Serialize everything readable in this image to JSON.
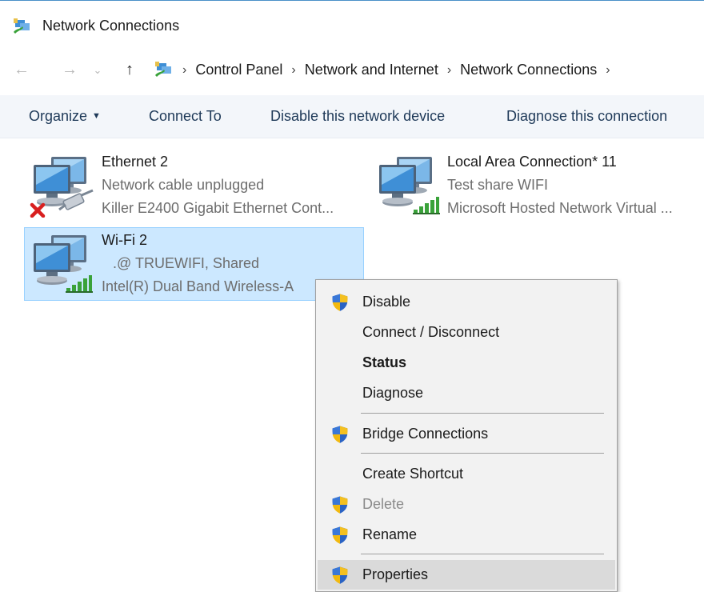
{
  "window": {
    "title": "Network Connections"
  },
  "address": {
    "breadcrumbs": [
      "Control Panel",
      "Network and Internet",
      "Network Connections"
    ]
  },
  "toolbar": {
    "organize_label": "Organize",
    "connect_label": "Connect To",
    "disable_label": "Disable this network device",
    "diagnose_label": "Diagnose this connection"
  },
  "connections": [
    {
      "name": "Ethernet 2",
      "status": "Network cable unplugged",
      "device": "Killer E2400 Gigabit Ethernet Cont...",
      "icon": "ethernet-disconnected-icon",
      "selected": false
    },
    {
      "name": "Local Area Connection* 11",
      "status": "Test share WIFI",
      "device": "Microsoft Hosted Network Virtual ...",
      "icon": "wifi-network-icon",
      "selected": false
    },
    {
      "name": "Wi-Fi 2",
      "status": ".@  TRUEWIFI, Shared",
      "device": "Intel(R) Dual Band Wireless-A",
      "icon": "wifi-network-icon",
      "selected": true
    }
  ],
  "context_menu": {
    "items": [
      {
        "label": "Disable",
        "shield": true
      },
      {
        "label": "Connect / Disconnect",
        "shield": false
      },
      {
        "label": "Status",
        "shield": false,
        "bold": true
      },
      {
        "label": "Diagnose",
        "shield": false
      },
      {
        "label": "Bridge Connections",
        "shield": true
      },
      {
        "label": "Create Shortcut",
        "shield": false
      },
      {
        "label": "Delete",
        "shield": true,
        "disabled": true
      },
      {
        "label": "Rename",
        "shield": true
      },
      {
        "label": "Properties",
        "shield": true,
        "highlighted": true
      }
    ]
  },
  "colors": {
    "selection_bg": "#cce8ff",
    "selection_border": "#99d1ff",
    "commandbar_bg": "#f3f6fa",
    "menu_bg": "#f2f2f2",
    "menu_hover": "#dadada",
    "shield_blue": "#2b5fb4",
    "shield_yellow": "#f4c020"
  }
}
